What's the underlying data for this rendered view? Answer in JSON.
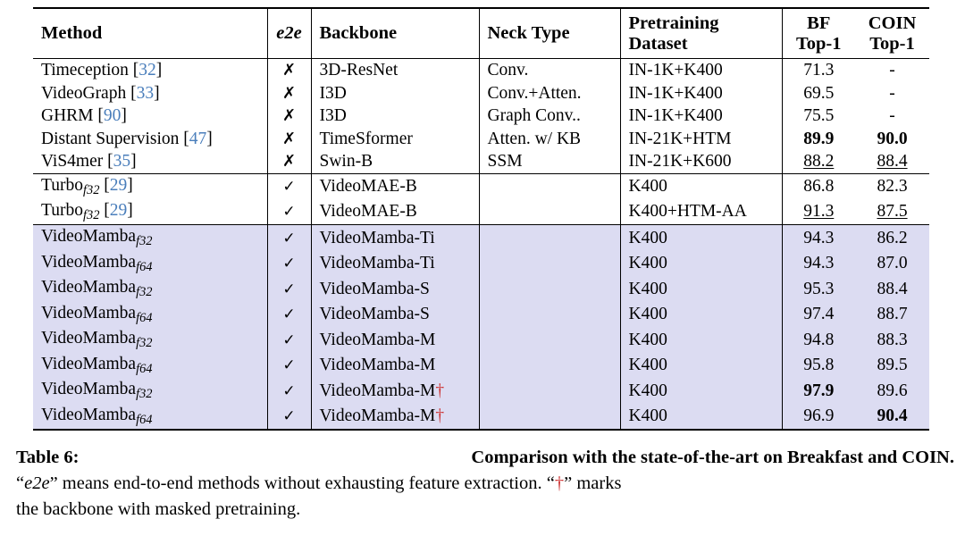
{
  "table": {
    "headers": {
      "method": "Method",
      "e2e": "e2e",
      "backbone": "Backbone",
      "neck": "Neck Type",
      "pretraining_line1": "Pretraining",
      "pretraining_line2": "Dataset",
      "bf_line1": "BF",
      "bf_line2": "Top-1",
      "coin_line1": "COIN",
      "coin_line2": "Top-1"
    },
    "icons": {
      "check": "✓",
      "cross": "✗",
      "dagger": "†"
    },
    "groups": [
      {
        "highlight": false,
        "rows": [
          {
            "method": "Timeception",
            "method_sub": "",
            "cite": "32",
            "e2e": "cross",
            "backbone": "3D-ResNet",
            "backbone_dagger": false,
            "neck": "Conv.",
            "pretraining": "IN-1K+K400",
            "bf": "71.3",
            "bf_style": "plain",
            "coin": "-",
            "coin_style": "plain"
          },
          {
            "method": "VideoGraph",
            "method_sub": "",
            "cite": "33",
            "e2e": "cross",
            "backbone": "I3D",
            "backbone_dagger": false,
            "neck": "Conv.+Atten.",
            "pretraining": "IN-1K+K400",
            "bf": "69.5",
            "bf_style": "plain",
            "coin": "-",
            "coin_style": "plain"
          },
          {
            "method": "GHRM",
            "method_sub": "",
            "cite": "90",
            "e2e": "cross",
            "backbone": "I3D",
            "backbone_dagger": false,
            "neck": "Graph Conv..",
            "pretraining": "IN-1K+K400",
            "bf": "75.5",
            "bf_style": "plain",
            "coin": "-",
            "coin_style": "plain"
          },
          {
            "method": "Distant Supervision",
            "method_sub": "",
            "cite": "47",
            "e2e": "cross",
            "backbone": "TimeSformer",
            "backbone_dagger": false,
            "neck": "Atten. w/ KB",
            "pretraining": "IN-21K+HTM",
            "bf": "89.9",
            "bf_style": "bold",
            "coin": "90.0",
            "coin_style": "bold"
          },
          {
            "method": "ViS4mer",
            "method_sub": "",
            "cite": "35",
            "e2e": "cross",
            "backbone": "Swin-B",
            "backbone_dagger": false,
            "neck": "SSM",
            "pretraining": "IN-21K+K600",
            "bf": "88.2",
            "bf_style": "underline",
            "coin": "88.4",
            "coin_style": "underline"
          }
        ]
      },
      {
        "highlight": false,
        "rows": [
          {
            "method": "Turbo",
            "method_sub": "f32",
            "cite": "29",
            "e2e": "check",
            "backbone": "VideoMAE-B",
            "backbone_dagger": false,
            "neck": "",
            "pretraining": "K400",
            "bf": "86.8",
            "bf_style": "plain",
            "coin": "82.3",
            "coin_style": "plain"
          },
          {
            "method": "Turbo",
            "method_sub": "f32",
            "cite": "29",
            "e2e": "check",
            "backbone": "VideoMAE-B",
            "backbone_dagger": false,
            "neck": "",
            "pretraining": "K400+HTM-AA",
            "bf": "91.3",
            "bf_style": "underline",
            "coin": "87.5",
            "coin_style": "underline"
          }
        ]
      },
      {
        "highlight": true,
        "rows": [
          {
            "method": "VideoMamba",
            "method_sub": "f32",
            "cite": "",
            "e2e": "check",
            "backbone": "VideoMamba-Ti",
            "backbone_dagger": false,
            "neck": "",
            "pretraining": "K400",
            "bf": "94.3",
            "bf_style": "plain",
            "coin": "86.2",
            "coin_style": "plain"
          },
          {
            "method": "VideoMamba",
            "method_sub": "f64",
            "cite": "",
            "e2e": "check",
            "backbone": "VideoMamba-Ti",
            "backbone_dagger": false,
            "neck": "",
            "pretraining": "K400",
            "bf": "94.3",
            "bf_style": "plain",
            "coin": "87.0",
            "coin_style": "plain"
          },
          {
            "method": "VideoMamba",
            "method_sub": "f32",
            "cite": "",
            "e2e": "check",
            "backbone": "VideoMamba-S",
            "backbone_dagger": false,
            "neck": "",
            "pretraining": "K400",
            "bf": "95.3",
            "bf_style": "plain",
            "coin": "88.4",
            "coin_style": "plain"
          },
          {
            "method": "VideoMamba",
            "method_sub": "f64",
            "cite": "",
            "e2e": "check",
            "backbone": "VideoMamba-S",
            "backbone_dagger": false,
            "neck": "",
            "pretraining": "K400",
            "bf": "97.4",
            "bf_style": "plain",
            "coin": "88.7",
            "coin_style": "plain"
          },
          {
            "method": "VideoMamba",
            "method_sub": "f32",
            "cite": "",
            "e2e": "check",
            "backbone": "VideoMamba-M",
            "backbone_dagger": false,
            "neck": "",
            "pretraining": "K400",
            "bf": "94.8",
            "bf_style": "plain",
            "coin": "88.3",
            "coin_style": "plain"
          },
          {
            "method": "VideoMamba",
            "method_sub": "f64",
            "cite": "",
            "e2e": "check",
            "backbone": "VideoMamba-M",
            "backbone_dagger": false,
            "neck": "",
            "pretraining": "K400",
            "bf": "95.8",
            "bf_style": "plain",
            "coin": "89.5",
            "coin_style": "plain"
          },
          {
            "method": "VideoMamba",
            "method_sub": "f32",
            "cite": "",
            "e2e": "check",
            "backbone": "VideoMamba-M",
            "backbone_dagger": true,
            "neck": "",
            "pretraining": "K400",
            "bf": "97.9",
            "bf_style": "bold",
            "coin": "89.6",
            "coin_style": "plain"
          },
          {
            "method": "VideoMamba",
            "method_sub": "f64",
            "cite": "",
            "e2e": "check",
            "backbone": "VideoMamba-M",
            "backbone_dagger": true,
            "neck": "",
            "pretraining": "K400",
            "bf": "96.9",
            "bf_style": "plain",
            "coin": "90.4",
            "coin_style": "bold"
          }
        ]
      }
    ]
  },
  "caption": {
    "label": "Table 6:",
    "title": "Comparison with the state-of-the-art on Breakfast and COIN.",
    "body_line2_a": "“",
    "body_e2e": "e2e",
    "body_line2_b": "” means end-to-end methods without exhausting feature extraction. “",
    "body_dagger": "†",
    "body_line2_c": "” marks",
    "body_line3": "the backbone with masked pretraining.",
    "full_text": "Table 6: Comparison with the state-of-the-art on Breakfast and COIN. “e2e” means end-to-end methods without exhausting feature extraction. “†” marks the backbone with masked pretraining."
  },
  "colors": {
    "highlight_row": "#dcdcf2",
    "citation_link": "#4a7ebb",
    "dagger": "#cc3333",
    "rule": "#000000",
    "background": "#ffffff"
  }
}
